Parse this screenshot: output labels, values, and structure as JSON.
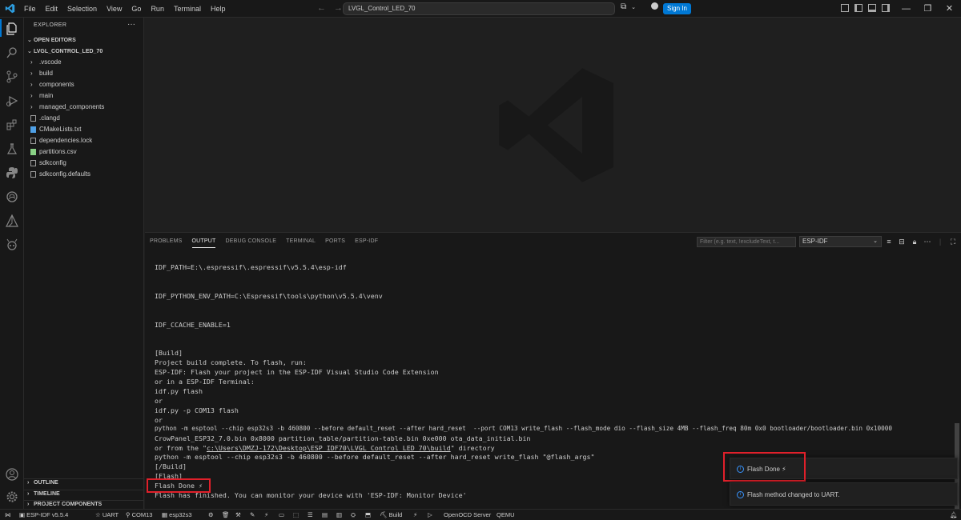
{
  "menu": [
    "File",
    "Edit",
    "Selection",
    "View",
    "Go",
    "Run",
    "Terminal",
    "Help"
  ],
  "search": {
    "value": "LVGL_Control_LED_70"
  },
  "signin_label": "Sign In",
  "colors": {
    "accent": "#0078d4",
    "highlight": "#e0202a",
    "info": "#3794ff"
  },
  "sidebar": {
    "title": "EXPLORER",
    "open_editors": "OPEN EDITORS",
    "project": "LVGL_CONTROL_LED_70",
    "items": [
      {
        "label": ".vscode",
        "kind": "folder"
      },
      {
        "label": "build",
        "kind": "folder"
      },
      {
        "label": "components",
        "kind": "folder"
      },
      {
        "label": "main",
        "kind": "folder"
      },
      {
        "label": "managed_components",
        "kind": "folder"
      },
      {
        "label": ".clangd",
        "kind": "file"
      },
      {
        "label": "CMakeLists.txt",
        "kind": "cmake"
      },
      {
        "label": "dependencies.lock",
        "kind": "file"
      },
      {
        "label": "partitions.csv",
        "kind": "csv"
      },
      {
        "label": "sdkconfig",
        "kind": "file"
      },
      {
        "label": "sdkconfig.defaults",
        "kind": "file"
      }
    ],
    "outline": "OUTLINE",
    "timeline": "TIMELINE",
    "project_components": "PROJECT COMPONENTS"
  },
  "panel": {
    "tabs": [
      "PROBLEMS",
      "OUTPUT",
      "DEBUG CONSOLE",
      "TERMINAL",
      "PORTS",
      "ESP-IDF"
    ],
    "active_tab": "OUTPUT",
    "filter_placeholder": "Filter (e.g. text, !excludeText, t...",
    "channel": "ESP-IDF",
    "lines": [
      "IDF_PATH=E:\\.espressif\\.espressif\\v5.5.4\\esp-idf",
      "IDF_PYTHON_ENV_PATH=C:\\Espressif\\tools\\python\\v5.5.4\\venv",
      "IDF_CCACHE_ENABLE=1",
      "[Build]",
      "Project build complete. To flash, run:",
      "ESP-IDF: Flash your project in the ESP-IDF Visual Studio Code Extension",
      "or in a ESP-IDF Terminal:",
      "idf.py flash",
      "or",
      "idf.py -p COM13 flash",
      "or",
      "python -m esptool --chip esp32s3 -b 460800 --before default_reset --after hard_reset  --port COM13 write_flash --flash_mode dio --flash_size 4MB --flash_freq 80m 0x0 bootloader/bootloader.bin 0x10000",
      "CrowPanel_ESP32_7.0.bin 0x8000 partition_table/partition-table.bin 0xe000 ota_data_initial.bin",
      "python -m esptool --chip esp32s3 -b 460800 --before default_reset --after hard_reset write_flash \"@flash_args\"",
      "[/Build]",
      "[Flash]",
      "Flash Done ⚡",
      "Flash has finished. You can monitor your device with 'ESP-IDF: Monitor Device'"
    ],
    "build_dir_prefix": "or from the \"",
    "build_dir_link": "c:\\Users\\DMZJ-172\\Desktop\\ESP_IDF70\\LVGL_Control_LED_70\\build",
    "build_dir_suffix": "\" directory"
  },
  "statusbar": {
    "idf_version": "ESP-IDF v5.5.4",
    "flash_method": "UART",
    "port": "COM13",
    "target": "esp32s3",
    "build": "Build",
    "openocd": "OpenOCD Server",
    "qemu": "QEMU"
  },
  "notifications": [
    {
      "text": "Flash Done ⚡"
    },
    {
      "text": "Flash method changed to UART."
    }
  ]
}
